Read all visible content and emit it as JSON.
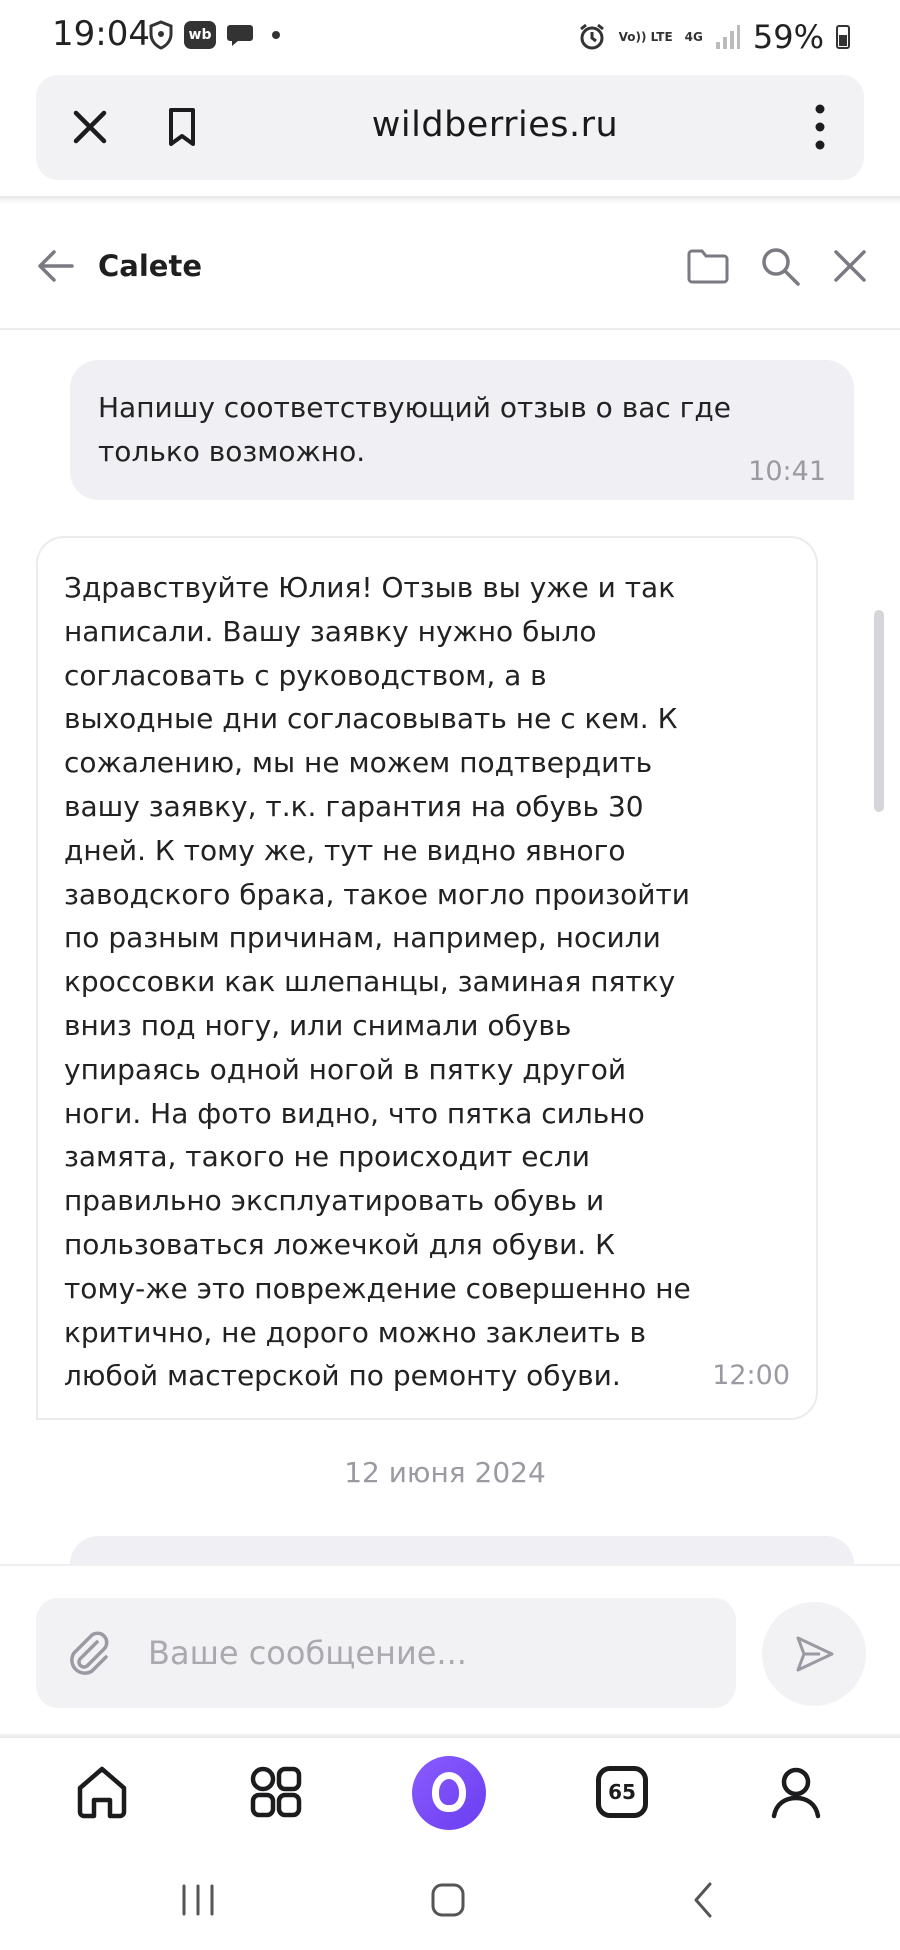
{
  "status_bar": {
    "time": "19:04",
    "wb_badge": "wb",
    "network": "Vo)) LTE",
    "network_type": "4G",
    "battery": "59%"
  },
  "browser": {
    "url": "wildberries.ru"
  },
  "chat": {
    "title": "Calete",
    "messages": [
      {
        "direction": "outgoing",
        "text": "Напишу соответствующий отзыв о вас где только возможно.",
        "time": "10:41"
      },
      {
        "direction": "incoming",
        "text": "Здравствуйте Юлия! Отзыв вы уже и так написали. Вашу заявку нужно было согласовать с руководством, а в выходные дни согласовывать не с кем. К сожалению, мы не можем подтвердить вашу заявку, т.к. гарантия на обувь 30 дней. К тому же, тут не видно явного заводского брака, такое могло произойти по разным причинам, например, носили кроссовки как шлепанцы, заминая пятку вниз под ногу, или снимали обувь упираясь одной ногой в пятку другой ноги. На фото видно, что пятка сильно замята, такого не происходит если правильно эксплуатировать обувь и пользоваться ложечкой для обуви. К тому-же это повреждение совершенно не критично, не дорого можно заклеить в любой мастерской по ремонту обуви.",
        "time": "12:00"
      }
    ],
    "date_separator": "12 июня 2024"
  },
  "composer": {
    "placeholder": "Ваше сообщение..."
  },
  "bottom_nav": {
    "basket_count": "65",
    "items": [
      "home-icon",
      "catalog-icon",
      "alice-icon",
      "basket-icon",
      "profile-icon"
    ]
  },
  "colors": {
    "accent": "#7b4cf6",
    "outgoing_bubble": "#f0f0f4",
    "muted_text": "#9a9aa2"
  }
}
